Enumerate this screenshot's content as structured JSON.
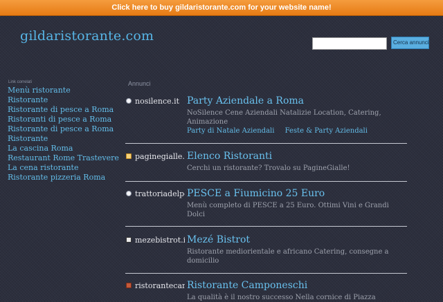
{
  "banner": {
    "text": "Click here to buy gildaristorante.com for your website name!"
  },
  "site": {
    "logo": "gildaristorante.com"
  },
  "search": {
    "placeholder": "",
    "button_label": "Cerca annunci"
  },
  "related": {
    "heading": "Link correlati",
    "items": [
      "Menù ristorante",
      "Ristorante",
      "Ristorante di pesce a Roma",
      "Ristoranti di pesce a Roma",
      "Ristorante di pesce a Roma",
      "Ristorante",
      "La cascina Roma",
      "Restaurant Rome Trastevere",
      "La cena ristorante",
      "Ristorante pizzeria Roma"
    ]
  },
  "ads": {
    "heading": "Annunci",
    "items": [
      {
        "source": "nosilence.it",
        "favicon": "globe-icon",
        "title": "Party Aziendale a Roma",
        "description": "NoSilence Cene Aziendali Natalizie Location, Catering, Animazione",
        "links": [
          "Party di Natale Aziendali",
          "Feste & Party Aziendali"
        ]
      },
      {
        "source": "paginegialle.it",
        "favicon": "paginegialle-icon",
        "title": "Elenco Ristoranti",
        "description": "Cerchi un ristorante? Trovalo su PagineGialle!",
        "links": []
      },
      {
        "source": "trattoriadelpesce.it",
        "favicon": "globe-icon",
        "title": "PESCE a Fiumicino 25 Euro",
        "description": "Menù completo di PESCE a 25 Euro. Ottimi Vini e Grandi Dolci",
        "links": []
      },
      {
        "source": "mezebistrot.it",
        "favicon": "mezebistrot-icon",
        "title": "Mezé Bistrot",
        "description": "Ristorante mediorientale e africano Catering, consegne a domicilio",
        "links": []
      },
      {
        "source": "ristorantecamponeschi.it",
        "favicon": "camponeschi-icon",
        "title": "Ristorante Camponeschi",
        "description": "La qualità è il nostro successo Nella cornice di Piazza",
        "links": []
      }
    ]
  }
}
